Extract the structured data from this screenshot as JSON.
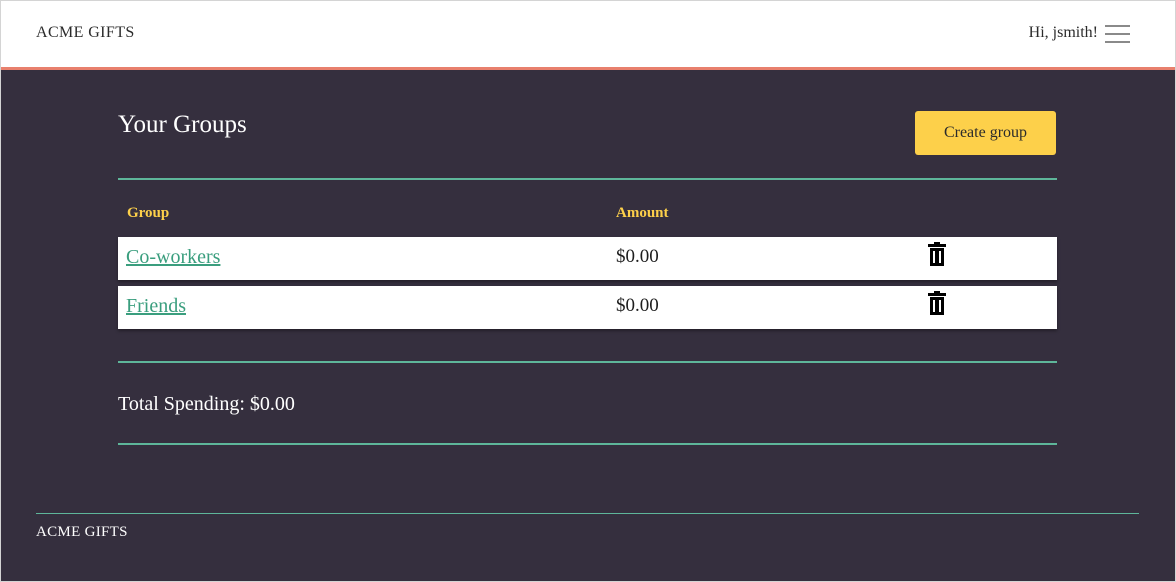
{
  "header": {
    "brand": "ACME GIFTS",
    "greeting": "Hi, jsmith!",
    "menu_icon": "hamburger-menu-icon"
  },
  "main": {
    "title": "Your Groups",
    "create_button": "Create group",
    "columns": [
      "Group",
      "Amount"
    ],
    "groups": [
      {
        "name": "Co-workers",
        "amount": "$0.00",
        "action_icon": "trash-icon"
      },
      {
        "name": "Friends",
        "amount": "$0.00",
        "action_icon": "trash-icon"
      }
    ],
    "total_label": "Total Spending: $0.00"
  },
  "footer": {
    "brand": "ACME GIFTS"
  },
  "colors": {
    "background": "#352f3e",
    "accent_yellow": "#fdd04a",
    "accent_green": "#5eb69a",
    "link_green": "#3a9e7e",
    "header_border": "#e8806d"
  }
}
